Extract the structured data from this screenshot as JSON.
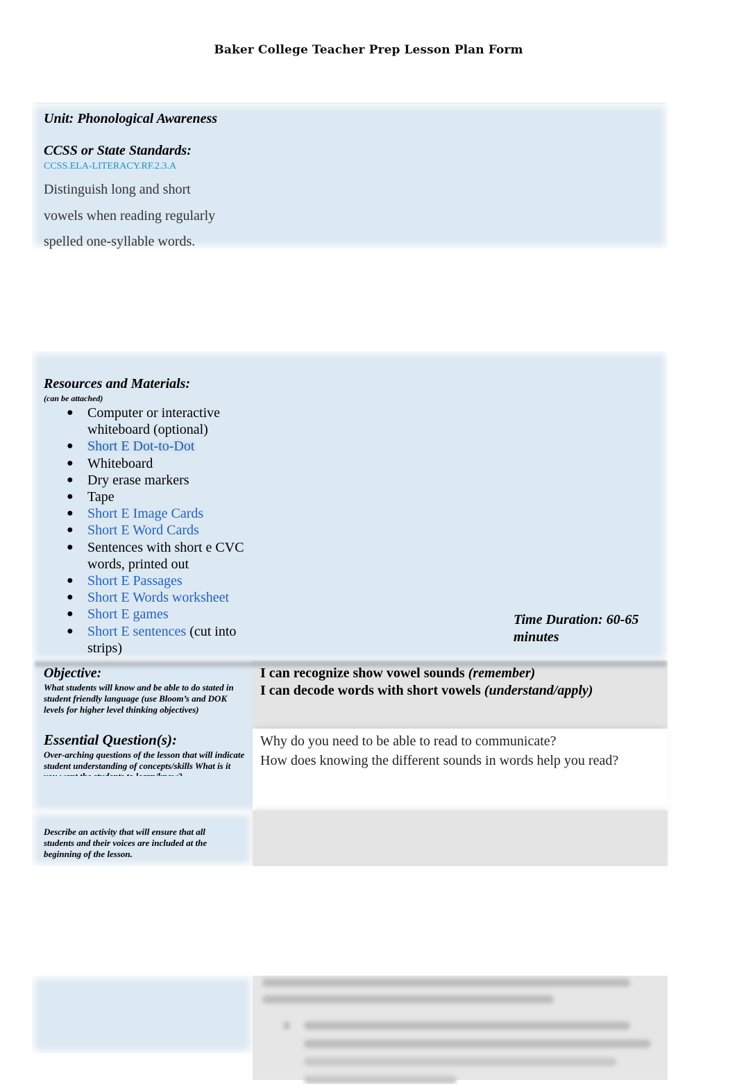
{
  "document": {
    "title": "Baker College Teacher Prep Lesson Plan Form"
  },
  "unit": {
    "label": "Unit: Phonological Awareness"
  },
  "standards": {
    "heading": "CCSS or State Standards:",
    "code": "CCSS.ELA-LITERACY.RF.2.3.A",
    "description_lines": [
      "Distinguish long and short",
      "vowels when reading regularly",
      "spelled one-syllable words."
    ]
  },
  "resources": {
    "heading": "Resources and Materials:",
    "subheading": "(can be attached)",
    "items": [
      {
        "text": "Computer or interactive whiteboard (optional)",
        "is_link": false,
        "suffix": ""
      },
      {
        "text": "Short E Dot-to-Dot",
        "is_link": true,
        "suffix": ""
      },
      {
        "text": "Whiteboard",
        "is_link": false,
        "suffix": ""
      },
      {
        "text": "Dry erase markers",
        "is_link": false,
        "suffix": ""
      },
      {
        "text": "Tape",
        "is_link": false,
        "suffix": ""
      },
      {
        "text": "Short E Image Cards",
        "is_link": true,
        "suffix": ""
      },
      {
        "text": "Short E Word Cards",
        "is_link": true,
        "suffix": ""
      },
      {
        "text": "Sentences with short e CVC words, printed out",
        "is_link": false,
        "suffix": ""
      },
      {
        "text": "Short E Passages",
        "is_link": true,
        "suffix": ""
      },
      {
        "text": "Short E Words worksheet",
        "is_link": true,
        "suffix": ""
      },
      {
        "text": "Short E games",
        "is_link": true,
        "suffix": ""
      },
      {
        "text": "Short E sentences",
        "is_link": true,
        "suffix": " (cut into strips)"
      }
    ],
    "bullet_glyph": "●"
  },
  "time_duration": {
    "label": "Time Duration: 60-65 minutes"
  },
  "objective": {
    "heading": "Objective:",
    "description": "What students will know and be able to do stated in student friendly language (use Bloom’s and DOK levels for higher level thinking objectives)",
    "statements": [
      {
        "text": "I can recognize show vowel sounds ",
        "level": "(remember)"
      },
      {
        "text": "I can decode words with short vowels ",
        "level": "(understand/apply)"
      }
    ]
  },
  "essential_questions": {
    "heading": "Essential Question(s):",
    "description": "Over-arching questions of the lesson that will indicate student understanding of concepts/skills What is it you want the students to learn/know?",
    "questions": [
      "Why do you need to be able to read to communicate?",
      "How does knowing the different sounds in words help you read?"
    ]
  },
  "inclusion_activity": {
    "description": "Describe an activity that will ensure that all students and their voices are included at the beginning of the lesson.",
    "response": ""
  },
  "colors": {
    "band_blue": "#dce8f2",
    "cell_gray": "#e4e4e4",
    "standard_code": "#1e90c8",
    "link_blue": "#1a5fb4"
  }
}
